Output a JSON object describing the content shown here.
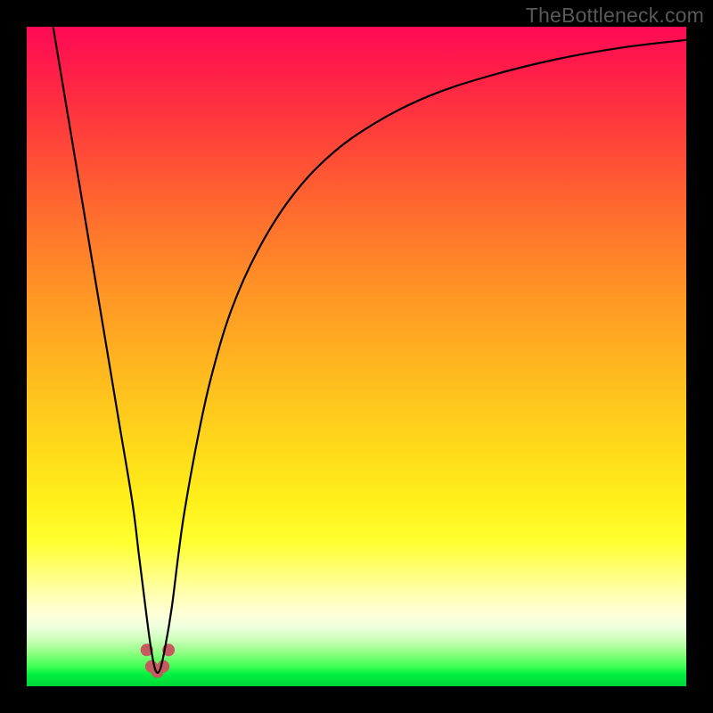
{
  "watermark": "TheBottleneck.com",
  "chart_data": {
    "type": "line",
    "title": "",
    "xlabel": "",
    "ylabel": "",
    "xlim": [
      0,
      100
    ],
    "ylim": [
      0,
      100
    ],
    "series": [
      {
        "name": "bottleneck-curve",
        "x": [
          4,
          6,
          8,
          10,
          12,
          14,
          16,
          17,
          18,
          18.8,
          19.5,
          20.2,
          21,
          22,
          23,
          24,
          26,
          28,
          31,
          35,
          40,
          46,
          53,
          61,
          70,
          80,
          90,
          100
        ],
        "values": [
          100,
          88,
          76,
          64,
          52,
          40,
          28,
          20,
          12,
          6,
          2.5,
          2.5,
          6,
          12,
          20,
          27,
          38,
          47,
          57,
          66,
          74,
          80.5,
          85.5,
          89.5,
          92.5,
          95,
          96.8,
          98
        ]
      }
    ],
    "markers": {
      "name": "trough-dots",
      "color": "#c75a5f",
      "points": [
        {
          "x": 18.2,
          "y": 5.5
        },
        {
          "x": 18.9,
          "y": 3.0
        },
        {
          "x": 19.8,
          "y": 2.2
        },
        {
          "x": 20.7,
          "y": 3.0
        },
        {
          "x": 21.5,
          "y": 5.5
        }
      ],
      "size": 14
    }
  }
}
